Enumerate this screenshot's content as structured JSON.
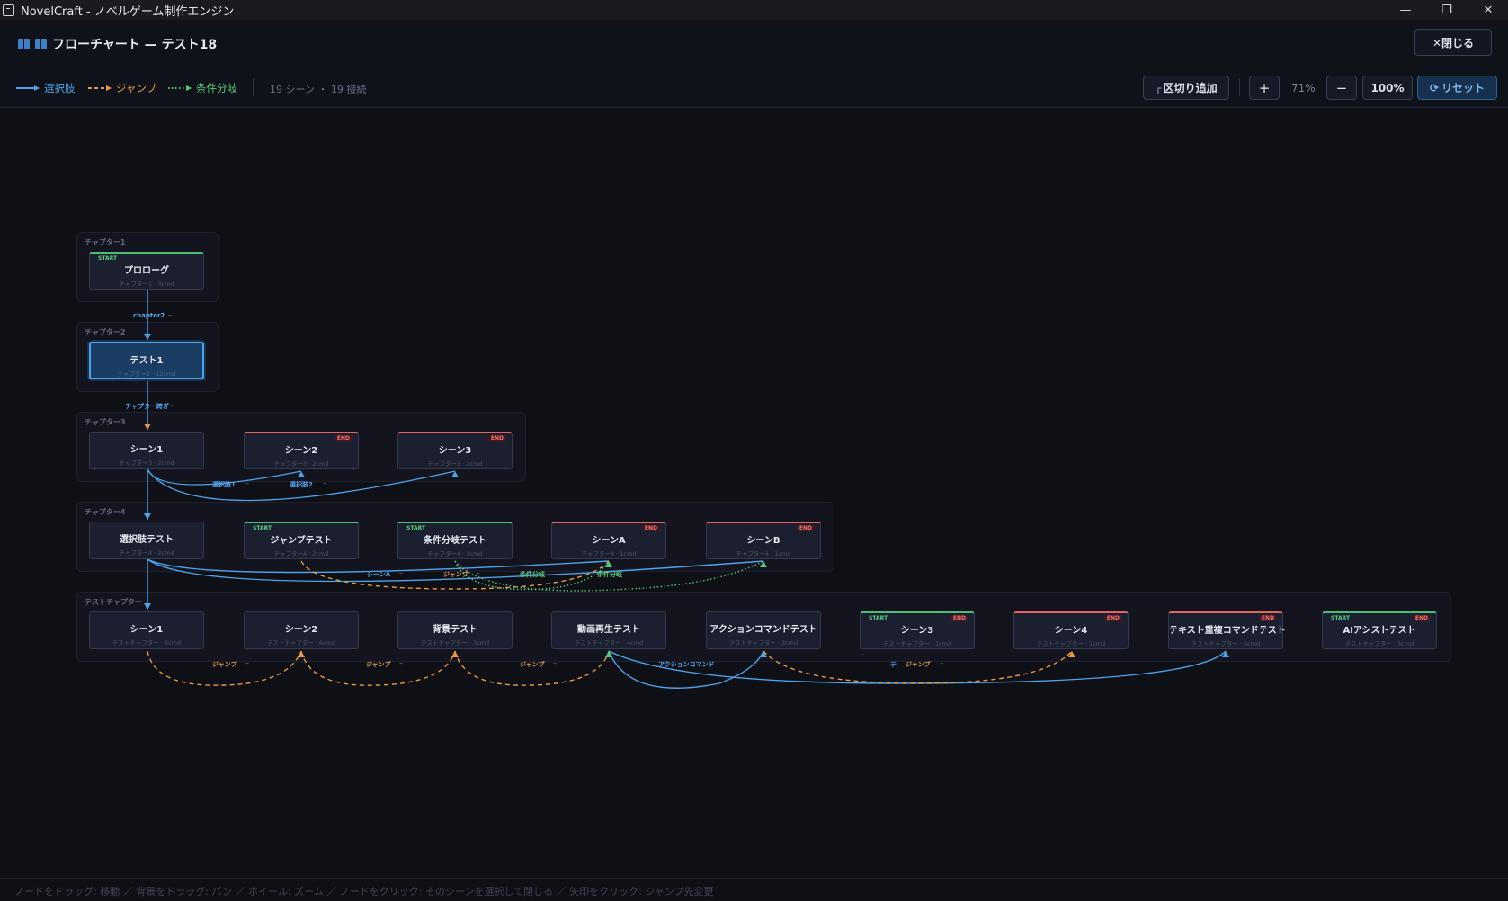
{
  "window": {
    "title": "NovelCraft - ノベルゲーム制作エンジン"
  },
  "header": {
    "title": "フローチャート — テスト18",
    "close_label": "✕閉じる"
  },
  "legend": [
    {
      "label": "選択肢",
      "color": "#4ea3ea",
      "style": "solid"
    },
    {
      "label": "ジャンプ",
      "color": "#e89a45",
      "style": "dashed"
    },
    {
      "label": "条件分岐",
      "color": "#55c97f",
      "style": "dotted"
    }
  ],
  "summary": "19 シーン ・ 19 接続",
  "toolbar": {
    "add_divider_label": "区切り追加",
    "zoom_in_label": "+",
    "zoom_level": "71%",
    "zoom_out_label": "−",
    "zoom_100_label": "100%",
    "reset_label": "リセット"
  },
  "chapters": [
    {
      "label": "チャプター1"
    },
    {
      "label": "チャプター2"
    },
    {
      "label": "チャプター3"
    },
    {
      "label": "チャプター4"
    },
    {
      "label": "テストチャプター"
    }
  ],
  "nodes": [
    {
      "title": "プロローグ",
      "sub": "チャプター1 · 3cmd",
      "badge": "START"
    },
    {
      "title": "テスト1",
      "sub": "チャプター2 · 12cmd",
      "selected": true
    },
    {
      "title": "シーン1",
      "sub": "チャプター3 · 2cmd"
    },
    {
      "title": "シーン2",
      "sub": "チャプター3 · 2cmd",
      "badge": "END"
    },
    {
      "title": "シーン3",
      "sub": "チャプター3 · 2cmd",
      "badge": "END"
    },
    {
      "title": "選択肢テスト",
      "sub": "チャプター4 · 2cmd"
    },
    {
      "title": "ジャンプテスト",
      "sub": "チャプター4 · 2cmd",
      "badge": "START"
    },
    {
      "title": "条件分岐テスト",
      "sub": "チャプター4 · 3cmd",
      "badge": "START"
    },
    {
      "title": "シーンA",
      "sub": "チャプター4 · 1cmd",
      "badge": "END"
    },
    {
      "title": "シーンB",
      "sub": "チャプター4 · 1cmd",
      "badge": "END"
    },
    {
      "title": "シーン1",
      "sub": "テストチャプター · 5cmd"
    },
    {
      "title": "シーン2",
      "sub": "テストチャプター · 6cmd"
    },
    {
      "title": "背景テスト",
      "sub": "テストチャプター · 3cmd"
    },
    {
      "title": "動画再生テスト",
      "sub": "テストチャプター · 4cmd"
    },
    {
      "title": "アクションコマンドテスト",
      "sub": "テストチャプター · 3cmd"
    },
    {
      "title": "シーン3",
      "sub": "テストチャプター · 1cmd",
      "badge": "START END"
    },
    {
      "title": "シーン4",
      "sub": "テストチャプター · 1cmd",
      "badge": "END"
    },
    {
      "title": "テキスト重複コマンドテスト",
      "sub": "テストチャプター · 6cmd",
      "badge": "END"
    },
    {
      "title": "AIアシストテスト",
      "sub": "テストチャプター · 3cmd",
      "badge": "START END"
    }
  ],
  "edge_labels": [
    {
      "text": "chapter2",
      "kind": "choice"
    },
    {
      "text": "チャプター跨ぎー",
      "kind": "choice"
    },
    {
      "text": "選択肢1",
      "kind": "choice"
    },
    {
      "text": "選択肢2",
      "kind": "choice"
    },
    {
      "text": "シーンA",
      "kind": "choice"
    },
    {
      "text": "ジャンプ",
      "kind": "jump"
    },
    {
      "text": "条件分岐",
      "kind": "condition"
    },
    {
      "text": "条件分岐",
      "kind": "condition"
    },
    {
      "text": "ジャンプ",
      "kind": "jump"
    },
    {
      "text": "ジャンプ",
      "kind": "jump"
    },
    {
      "text": "ジャンプ",
      "kind": "jump"
    },
    {
      "text": "アクションコマンド",
      "kind": "choice"
    },
    {
      "text": "テ",
      "kind": "choice"
    },
    {
      "text": "ジャンプ",
      "kind": "jump"
    }
  ],
  "hint": "ノードをドラッグ: 移動 ／ 背景をドラッグ: パン ／ ホイール: ズーム ／ ノードをクリック: そのシーンを選択して閉じる ／ 矢印をクリック: ジャンプ先変更",
  "colors": {
    "choice": "#4ea3ea",
    "jump": "#e89a45",
    "condition": "#55c97f",
    "start": "#4dbd74",
    "end": "#e06461"
  }
}
